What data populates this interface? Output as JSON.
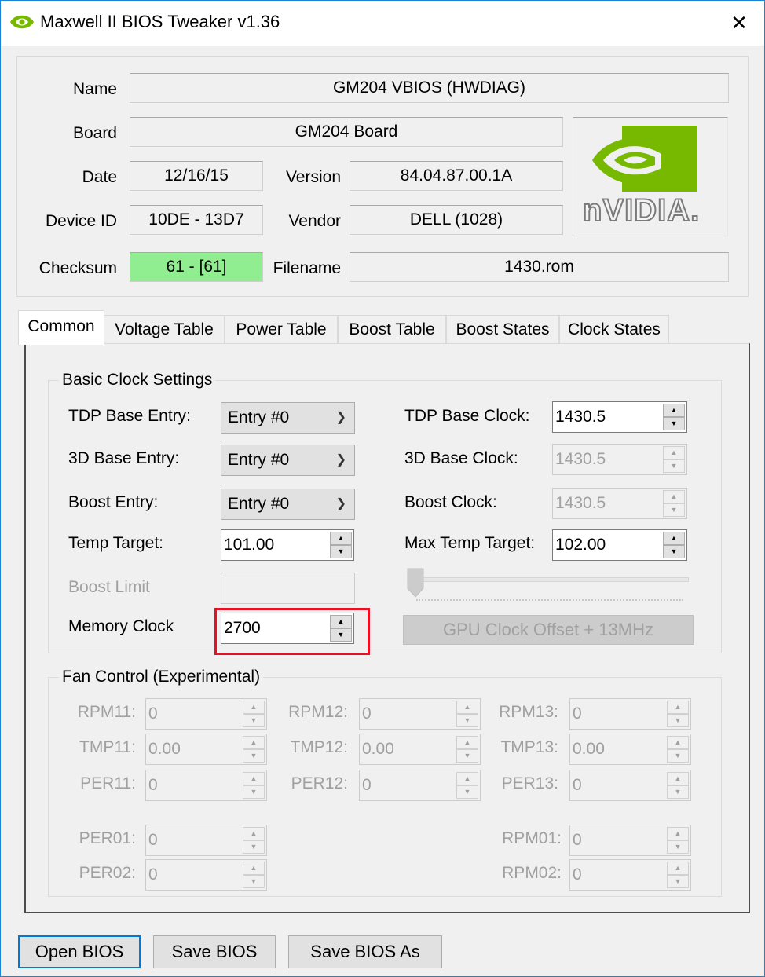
{
  "window": {
    "title": "Maxwell II BIOS Tweaker v1.36",
    "close_glyph": "✕"
  },
  "info": {
    "name_label": "Name",
    "name_value": "GM204 VBIOS (HWDIAG)",
    "board_label": "Board",
    "board_value": "GM204 Board",
    "date_label": "Date",
    "date_value": "12/16/15",
    "version_label": "Version",
    "version_value": "84.04.87.00.1A",
    "device_label": "Device ID",
    "device_value": "10DE - 13D7",
    "vendor_label": "Vendor",
    "vendor_value": "DELL (1028)",
    "checksum_label": "Checksum",
    "checksum_value": "61 - [61]",
    "filename_label": "Filename",
    "filename_value": "1430.rom",
    "logo_text": "nVIDIA."
  },
  "tabs": [
    "Common",
    "Voltage Table",
    "Power Table",
    "Boost Table",
    "Boost States",
    "Clock States"
  ],
  "clock": {
    "group_title": "Basic Clock Settings",
    "tdp_entry_label": "TDP Base Entry:",
    "tdp_entry_value": "Entry #0",
    "d3_entry_label": "3D Base Entry:",
    "d3_entry_value": "Entry #0",
    "boost_entry_label": "Boost Entry:",
    "boost_entry_value": "Entry #0",
    "temp_target_label": "Temp Target:",
    "temp_target_value": "101.00",
    "boost_limit_label": "Boost Limit",
    "memory_clock_label": "Memory Clock",
    "memory_clock_value": "2700",
    "tdp_clock_label": "TDP Base Clock:",
    "tdp_clock_value": "1430.5",
    "d3_clock_label": "3D Base Clock:",
    "d3_clock_value": "1430.5",
    "boost_clock_label": "Boost Clock:",
    "boost_clock_value": "1430.5",
    "max_temp_label": "Max Temp Target:",
    "max_temp_value": "102.00",
    "offset_button": "GPU Clock Offset + 13MHz"
  },
  "fan": {
    "group_title": "Fan Control (Experimental)",
    "rpm11_label": "RPM11:",
    "rpm11_value": "0",
    "tmp11_label": "TMP11:",
    "tmp11_value": "0.00",
    "per11_label": "PER11:",
    "per11_value": "0",
    "rpm12_label": "RPM12:",
    "rpm12_value": "0",
    "tmp12_label": "TMP12:",
    "tmp12_value": "0.00",
    "per12_label": "PER12:",
    "per12_value": "0",
    "rpm13_label": "RPM13:",
    "rpm13_value": "0",
    "tmp13_label": "TMP13:",
    "tmp13_value": "0.00",
    "per13_label": "PER13:",
    "per13_value": "0",
    "per01_label": "PER01:",
    "per01_value": "0",
    "per02_label": "PER02:",
    "per02_value": "0",
    "rpm01_label": "RPM01:",
    "rpm01_value": "0",
    "rpm02_label": "RPM02:",
    "rpm02_value": "0"
  },
  "buttons": {
    "open": "Open BIOS",
    "save": "Save BIOS",
    "save_as": "Save BIOS As"
  },
  "colors": {
    "checksum_ok": "#90ee90",
    "highlight": "#e81123",
    "accent": "#0078d7",
    "nvidia_green": "#76b900"
  }
}
